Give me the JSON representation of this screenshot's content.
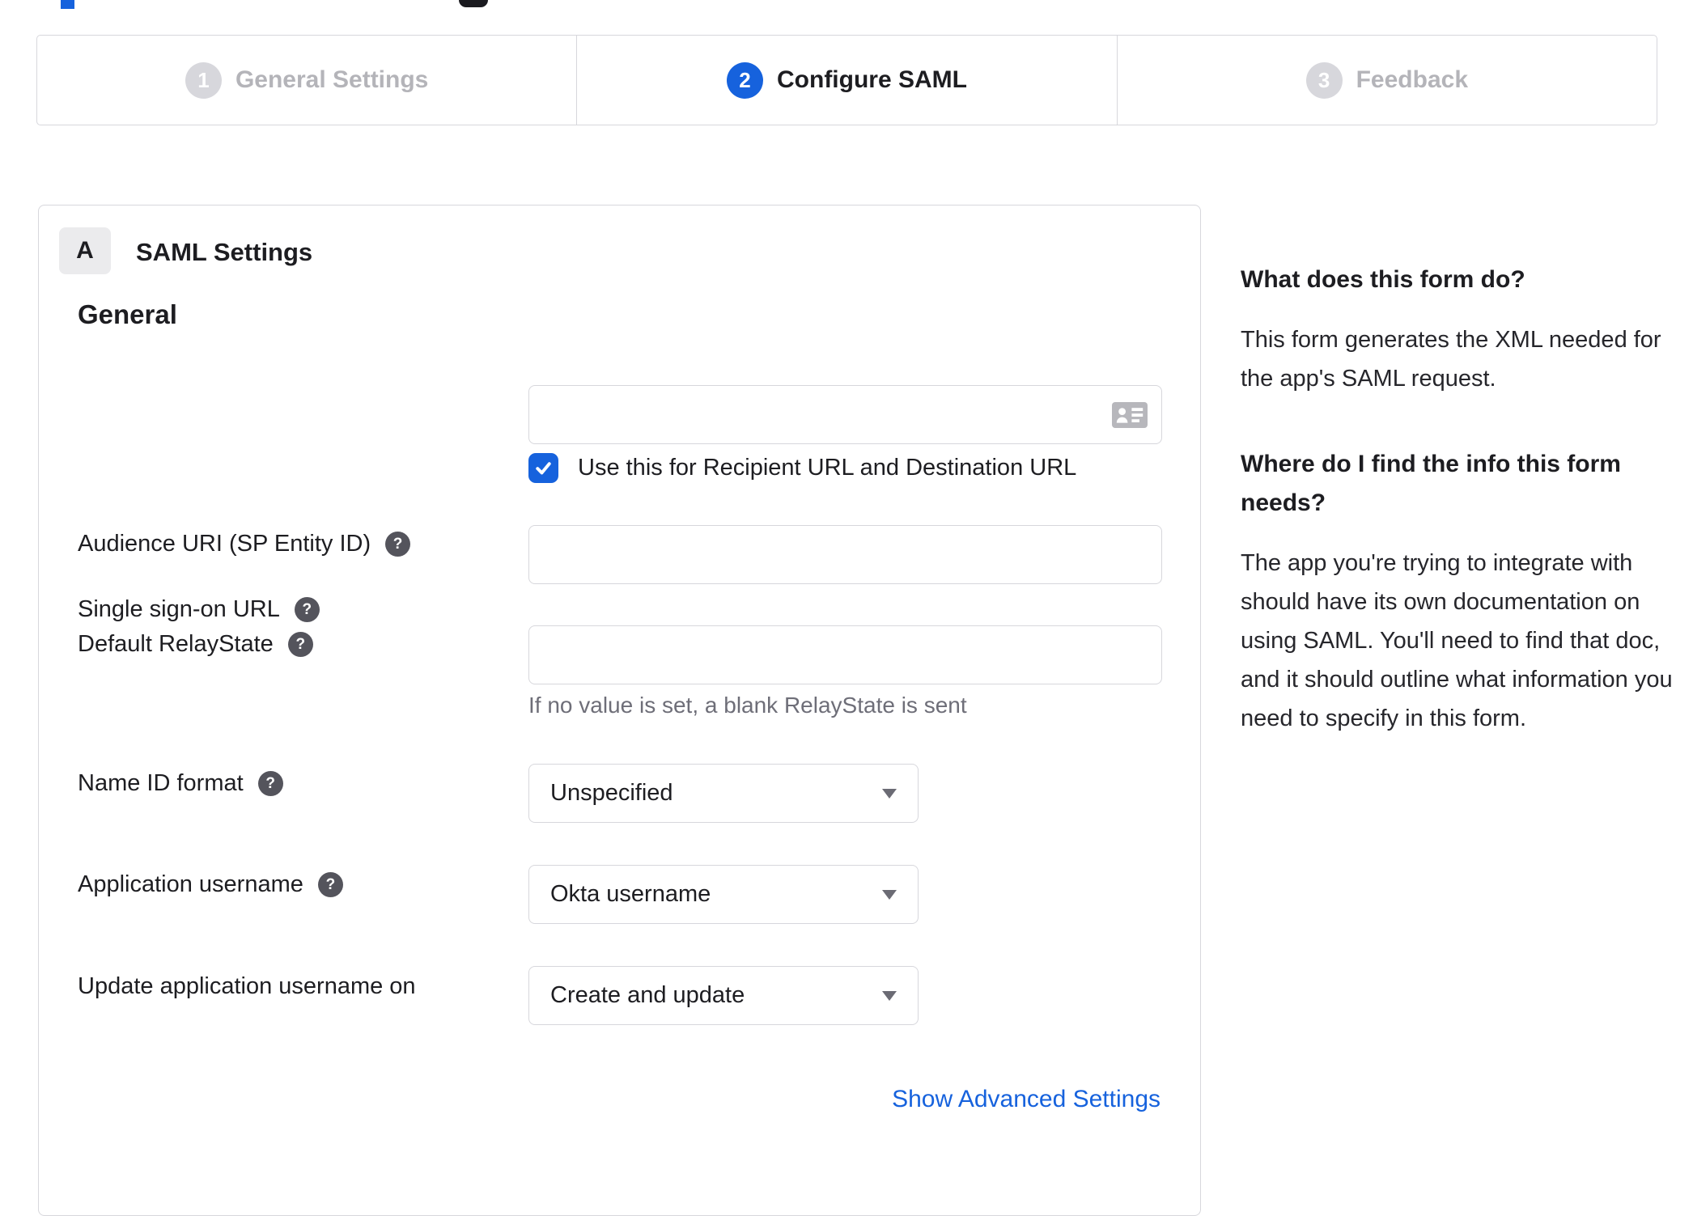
{
  "stepper": {
    "steps": [
      {
        "number": "1",
        "label": "General Settings",
        "active": false
      },
      {
        "number": "2",
        "label": "Configure SAML",
        "active": true
      },
      {
        "number": "3",
        "label": "Feedback",
        "active": false
      }
    ]
  },
  "panel": {
    "badge": "A",
    "title": "SAML Settings",
    "section_heading": "General",
    "fields": {
      "sso_url": {
        "label": "Single sign-on URL",
        "value": "",
        "checkbox_label": "Use this for Recipient URL and Destination URL",
        "checkbox_checked": true
      },
      "audience_uri": {
        "label": "Audience URI (SP Entity ID)",
        "value": ""
      },
      "default_relaystate": {
        "label": "Default RelayState",
        "value": "",
        "hint": "If no value is set, a blank RelayState is sent"
      },
      "name_id_format": {
        "label": "Name ID format",
        "value": "Unspecified"
      },
      "application_username": {
        "label": "Application username",
        "value": "Okta username"
      },
      "update_application_username_on": {
        "label": "Update application username on",
        "value": "Create and update"
      }
    },
    "advanced_link": "Show Advanced Settings"
  },
  "sidebar": {
    "heading1": "What does this form do?",
    "paragraph1": "This form generates the XML needed for the app's SAML request.",
    "heading2": "Where do I find the info this form needs?",
    "paragraph2": "The app you're trying to integrate with should have its own documentation on using SAML. You'll need to find that doc, and it should outline what information you need to specify in this form."
  },
  "colors": {
    "accent_blue": "#1662dd",
    "inactive_gray": "#d7d7dc",
    "border_gray": "#d7d7dc",
    "help_icon_bg": "#54545c",
    "hint_gray": "#6e6e78"
  }
}
